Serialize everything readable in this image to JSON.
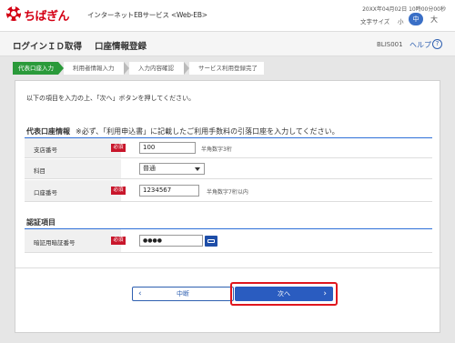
{
  "header": {
    "logo_text": "ちばぎん",
    "service_name": "インターネットEBサービス <Web-EB>",
    "datetime": "20XX年04月02日 10時00分00秒",
    "font_size_label": "文字サイズ",
    "font_small": "小",
    "font_mid": "中",
    "font_large": "大"
  },
  "titlebar": {
    "left_title": "ログインＩＤ取得",
    "main_title": "口座情報登録",
    "screen_id": "BLIS001",
    "help": "ヘルプ"
  },
  "steps": [
    {
      "label": "代表口座入力",
      "active": true
    },
    {
      "label": "利用者情報入力",
      "active": false
    },
    {
      "label": "入力内容確認",
      "active": false
    },
    {
      "label": "サービス利用登録完了",
      "active": false
    }
  ],
  "instructions": "以下の項目を入力の上、「次へ」ボタンを押してください。",
  "account_section": {
    "title": "代表口座情報",
    "note": "※必ず、「利用申込書」に記載したご利用手数料の引落口座を入力してください。",
    "branch_label": "支店番号",
    "branch_value": "100",
    "branch_hint": "半角数字3桁",
    "subject_label": "科目",
    "subject_value": "普通",
    "account_label": "口座番号",
    "account_value": "1234567",
    "account_hint": "半角数字7桁以内",
    "required_badge": "必須"
  },
  "auth_section": {
    "title": "認証項目",
    "pin_label": "暗証用暗証番号",
    "pin_value": "●●●●",
    "required_badge": "必須"
  },
  "buttons": {
    "back": "中断",
    "next": "次へ"
  },
  "colors": {
    "brand": "#d40014",
    "accent": "#2a5cc0",
    "step_active": "#2a9a3a",
    "highlight": "#e0161e"
  }
}
